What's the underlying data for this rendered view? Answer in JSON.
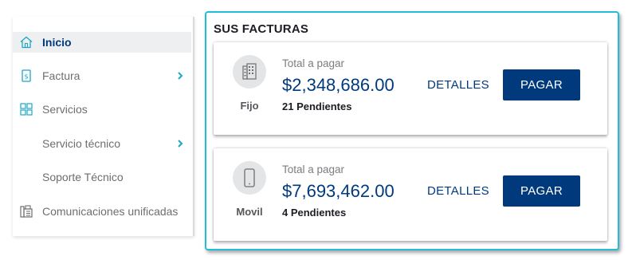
{
  "sidebar": {
    "items": [
      {
        "label": "Inicio",
        "icon": "home-icon",
        "active": true
      },
      {
        "label": "Factura",
        "icon": "bill-icon",
        "chevron": true
      },
      {
        "label": "Servicios",
        "icon": "grid-icon"
      },
      {
        "label": "Servicio técnico",
        "chevron": true
      },
      {
        "label": "Soporte Técnico"
      },
      {
        "label": "Comunicaciones unificadas",
        "icon": "fax-icon"
      }
    ]
  },
  "invoices": {
    "title": "SUS FACTURAS",
    "cards": [
      {
        "type": "Fijo",
        "icon": "building-icon",
        "total_label": "Total a pagar",
        "amount": "$2,348,686.00",
        "pending": "21 Pendientes",
        "details_label": "DETALLES",
        "pay_label": "PAGAR"
      },
      {
        "type": "Movil",
        "icon": "mobile-phone-icon",
        "total_label": "Total a pagar",
        "amount": "$7,693,462.00",
        "pending": "4 Pendientes",
        "details_label": "DETALLES",
        "pay_label": "PAGAR"
      }
    ]
  },
  "colors": {
    "brand_blue": "#003a7d",
    "accent_cyan": "#21bdd9",
    "icon_cyan": "#1aa8c4"
  }
}
